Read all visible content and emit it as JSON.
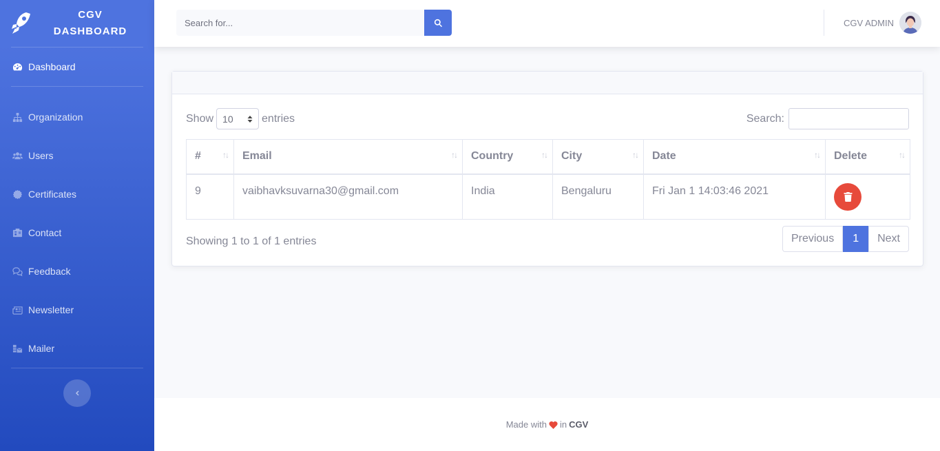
{
  "brand": {
    "line1": "CGV",
    "line2": "DASHBOARD",
    "icon": "rocket-icon"
  },
  "sidebar": {
    "active": {
      "label": "Dashboard",
      "icon": "tachometer-icon"
    },
    "items": [
      {
        "label": "Organization",
        "icon": "sitemap-icon"
      },
      {
        "label": "Users",
        "icon": "users-icon"
      },
      {
        "label": "Certificates",
        "icon": "certificate-icon"
      },
      {
        "label": "Contact",
        "icon": "address-card-icon"
      },
      {
        "label": "Feedback",
        "icon": "comments-icon"
      },
      {
        "label": "Newsletter",
        "icon": "newspaper-icon"
      },
      {
        "label": "Mailer",
        "icon": "mail-bulk-icon"
      }
    ],
    "toggle_icon": "chevron-left-icon"
  },
  "topbar": {
    "search_placeholder": "Search for...",
    "user_name": "CGV ADMIN"
  },
  "table_controls": {
    "show_label": "Show",
    "entries_label": "entries",
    "page_length": "10",
    "search_label": "Search:"
  },
  "table": {
    "headers": [
      "#",
      "Email",
      "Country",
      "City",
      "Date",
      "Delete"
    ],
    "rows": [
      {
        "id": "9",
        "email": "vaibhavksuvarna30@gmail.com",
        "country": "India",
        "city": "Bengaluru",
        "date": "Fri Jan 1 14:03:46 2021"
      }
    ]
  },
  "info": "Showing 1 to 1 of 1 entries",
  "pagination": {
    "previous": "Previous",
    "current": "1",
    "next": "Next"
  },
  "footer": {
    "made_with": "Made with",
    "in": "in",
    "brand": "CGV"
  },
  "colors": {
    "primary": "#4e73df",
    "danger": "#e74a3b",
    "sidebar_end": "#224abe"
  }
}
